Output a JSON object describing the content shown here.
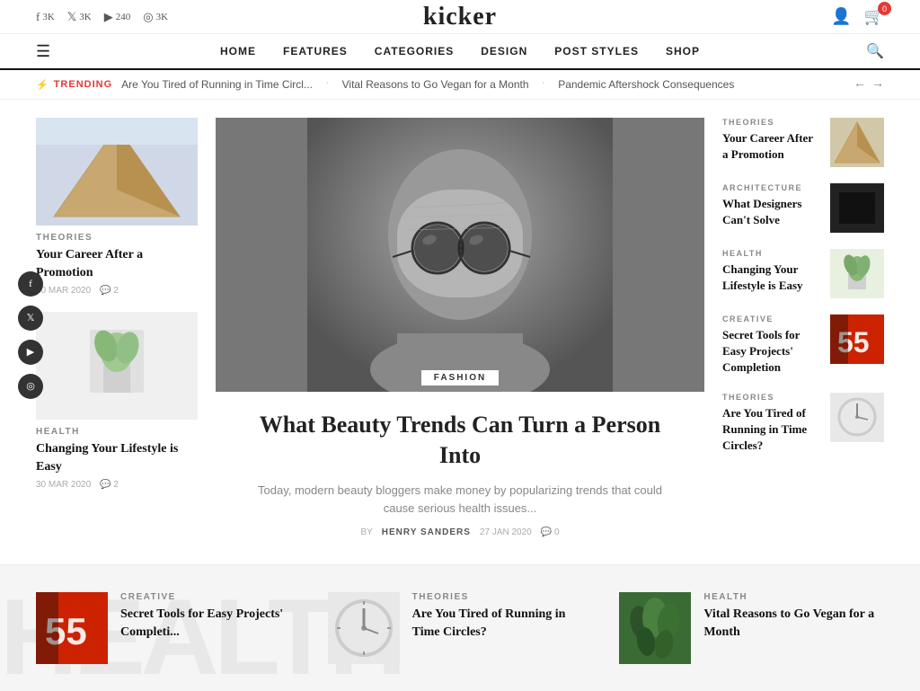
{
  "site": {
    "name": "kicker"
  },
  "topbar": {
    "social": [
      {
        "platform": "facebook",
        "icon": "f",
        "count": "3K"
      },
      {
        "platform": "twitter",
        "icon": "🐦",
        "count": "3K"
      },
      {
        "platform": "youtube",
        "icon": "▶",
        "count": "240"
      },
      {
        "platform": "instagram",
        "icon": "📷",
        "count": "3K"
      }
    ],
    "cart_count": "0"
  },
  "nav": {
    "hamburger_label": "☰",
    "items": [
      {
        "label": "HOME"
      },
      {
        "label": "FEATURES"
      },
      {
        "label": "CATEGORIES"
      },
      {
        "label": "DESIGN"
      },
      {
        "label": "POST STYLES"
      },
      {
        "label": "SHOP"
      }
    ],
    "search_label": "🔍"
  },
  "trending": {
    "label": "TRENDING",
    "icon": "⚡",
    "items": [
      "Are You Tired of Running in Time Circl...",
      "Vital Reasons to Go Vegan for a Month",
      "Pandemic Aftershock Consequences"
    ],
    "prev_arrow": "←",
    "next_arrow": "→"
  },
  "left_articles": [
    {
      "category": "THEORIES",
      "title": "Your Career After a Promotion",
      "date": "30 MAR 2020",
      "comments": "2",
      "img_color": "#d0d8e0"
    },
    {
      "category": "HEALTH",
      "title": "Changing Your Lifestyle is Easy",
      "date": "30 MAR 2020",
      "comments": "2",
      "img_color": "#c8d8c0"
    }
  ],
  "featured": {
    "category": "FASHION",
    "title": "What Beauty Trends Can Turn a Person Into",
    "excerpt": "Today, modern beauty bloggers make money by popularizing trends that could cause serious health issues...",
    "author": "HENRY SANDERS",
    "date": "27 JAN 2020",
    "comments": "0"
  },
  "right_articles": [
    {
      "category": "THEORIES",
      "title": "Your Career After a Promotion",
      "img_color": "#c8b88a"
    },
    {
      "category": "ARCHITECTURE",
      "title": "What Designers Can't Solve",
      "img_color": "#222"
    },
    {
      "category": "HEALTH",
      "title": "Changing Your Lifestyle is Easy",
      "img_color": "#b8d4b8"
    },
    {
      "category": "CREATIVE",
      "title": "Secret Tools for Easy Projects' Completion",
      "img_color": "#cc2200"
    },
    {
      "category": "THEORIES",
      "title": "Are You Tired of Running in Time Circles?",
      "img_color": "#ccc"
    }
  ],
  "social_sidebar": [
    {
      "icon": "f",
      "platform": "facebook"
    },
    {
      "icon": "🐦",
      "platform": "twitter"
    },
    {
      "icon": "▶",
      "platform": "youtube"
    },
    {
      "icon": "📷",
      "platform": "instagram"
    }
  ],
  "bottom_articles": [
    {
      "category": "CREATIVE",
      "title": "Secret Tools for Easy Projects' Completi...",
      "img_color": "#cc2200"
    },
    {
      "category": "THEORIES",
      "title": "Are You Tired of Running in Time Circles?",
      "img_color": "#d0d0d0"
    },
    {
      "category": "HEALTH",
      "title": "Vital Reasons to Go Vegan for a Month",
      "img_color": "#3a6b35"
    }
  ]
}
